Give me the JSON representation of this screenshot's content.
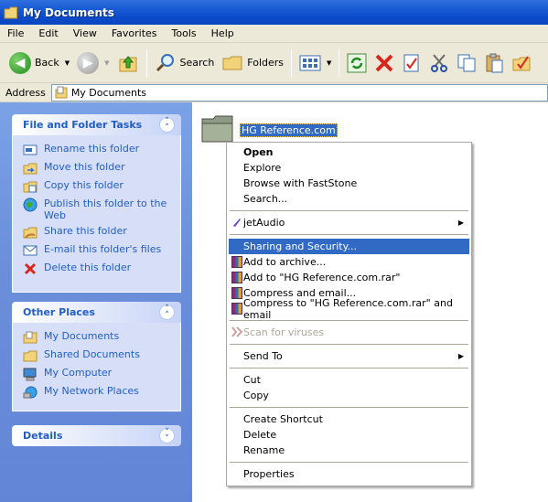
{
  "window": {
    "title": "My Documents"
  },
  "menubar": [
    "File",
    "Edit",
    "View",
    "Favorites",
    "Tools",
    "Help"
  ],
  "toolbar": {
    "back": "Back",
    "search": "Search",
    "folders": "Folders"
  },
  "address": {
    "label": "Address",
    "value": "My Documents"
  },
  "tasks_panel": {
    "title": "File and Folder Tasks",
    "items": [
      {
        "label": "Rename this folder",
        "icon": "rename-icon"
      },
      {
        "label": "Move this folder",
        "icon": "move-icon"
      },
      {
        "label": "Copy this folder",
        "icon": "copy-icon"
      },
      {
        "label": "Publish this folder to the Web",
        "icon": "publish-web-icon"
      },
      {
        "label": "Share this folder",
        "icon": "share-icon"
      },
      {
        "label": "E-mail this folder's files",
        "icon": "email-icon"
      },
      {
        "label": "Delete this folder",
        "icon": "delete-x-icon"
      }
    ]
  },
  "places_panel": {
    "title": "Other Places",
    "items": [
      {
        "label": "My Documents",
        "icon": "folder-icon"
      },
      {
        "label": "Shared Documents",
        "icon": "folder-icon"
      },
      {
        "label": "My Computer",
        "icon": "computer-icon"
      },
      {
        "label": "My Network Places",
        "icon": "network-icon"
      }
    ]
  },
  "details_panel": {
    "title": "Details"
  },
  "folder": {
    "name": "HG Reference.com"
  },
  "context_menu": {
    "open": "Open",
    "explore": "Explore",
    "browse_faststone": "Browse with FastStone",
    "search": "Search...",
    "jetaudio": "jetAudio",
    "sharing": "Sharing and Security...",
    "add_archive": "Add to archive...",
    "add_rar": "Add to \"HG Reference.com.rar\"",
    "compress_email": "Compress and email...",
    "compress_rar_email": "Compress to \"HG Reference.com.rar\" and email",
    "scan": "Scan for viruses",
    "send_to": "Send To",
    "cut": "Cut",
    "copy": "Copy",
    "create_shortcut": "Create Shortcut",
    "delete": "Delete",
    "rename": "Rename",
    "properties": "Properties"
  },
  "colors": {
    "title_bar": "#0b4bcb",
    "highlight": "#316ac5",
    "link": "#215dc6",
    "left_pane": "#6b8fdb"
  }
}
